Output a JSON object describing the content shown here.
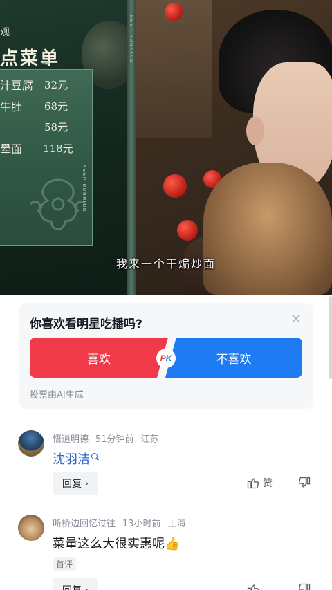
{
  "video": {
    "menu": {
      "header_fragment": "观",
      "title": "点菜单",
      "items": [
        {
          "name": "汁豆腐",
          "price": "32元"
        },
        {
          "name": "牛肚",
          "price": "68元"
        },
        {
          "name": "",
          "price": "58元"
        },
        {
          "name": "晕面",
          "price": "118元"
        }
      ],
      "brand_vertical": "KEEP RUNNING"
    },
    "subtitle": "我来一个干煸炒面"
  },
  "poll": {
    "question": "你喜欢看明星吃播吗?",
    "option_like": "喜欢",
    "option_dislike": "不喜欢",
    "pk_p": "P",
    "pk_k": "K",
    "note": "投票由AI生成",
    "colors": {
      "like": "#f03a4a",
      "dislike": "#1e7bf1"
    }
  },
  "comments": [
    {
      "username": "悟道明德",
      "time": "51分钟前",
      "location": "江苏",
      "text": "沈羽洁",
      "text_is_search_link": true,
      "reply_label": "回复",
      "like_label": "赞"
    },
    {
      "username": "断桥边回忆过往",
      "time": "13小时前",
      "location": "上海",
      "text": "菜量这么大很实惠呢",
      "emoji": "thumbs-up",
      "badge": "首评",
      "reply_label": "回复"
    }
  ]
}
